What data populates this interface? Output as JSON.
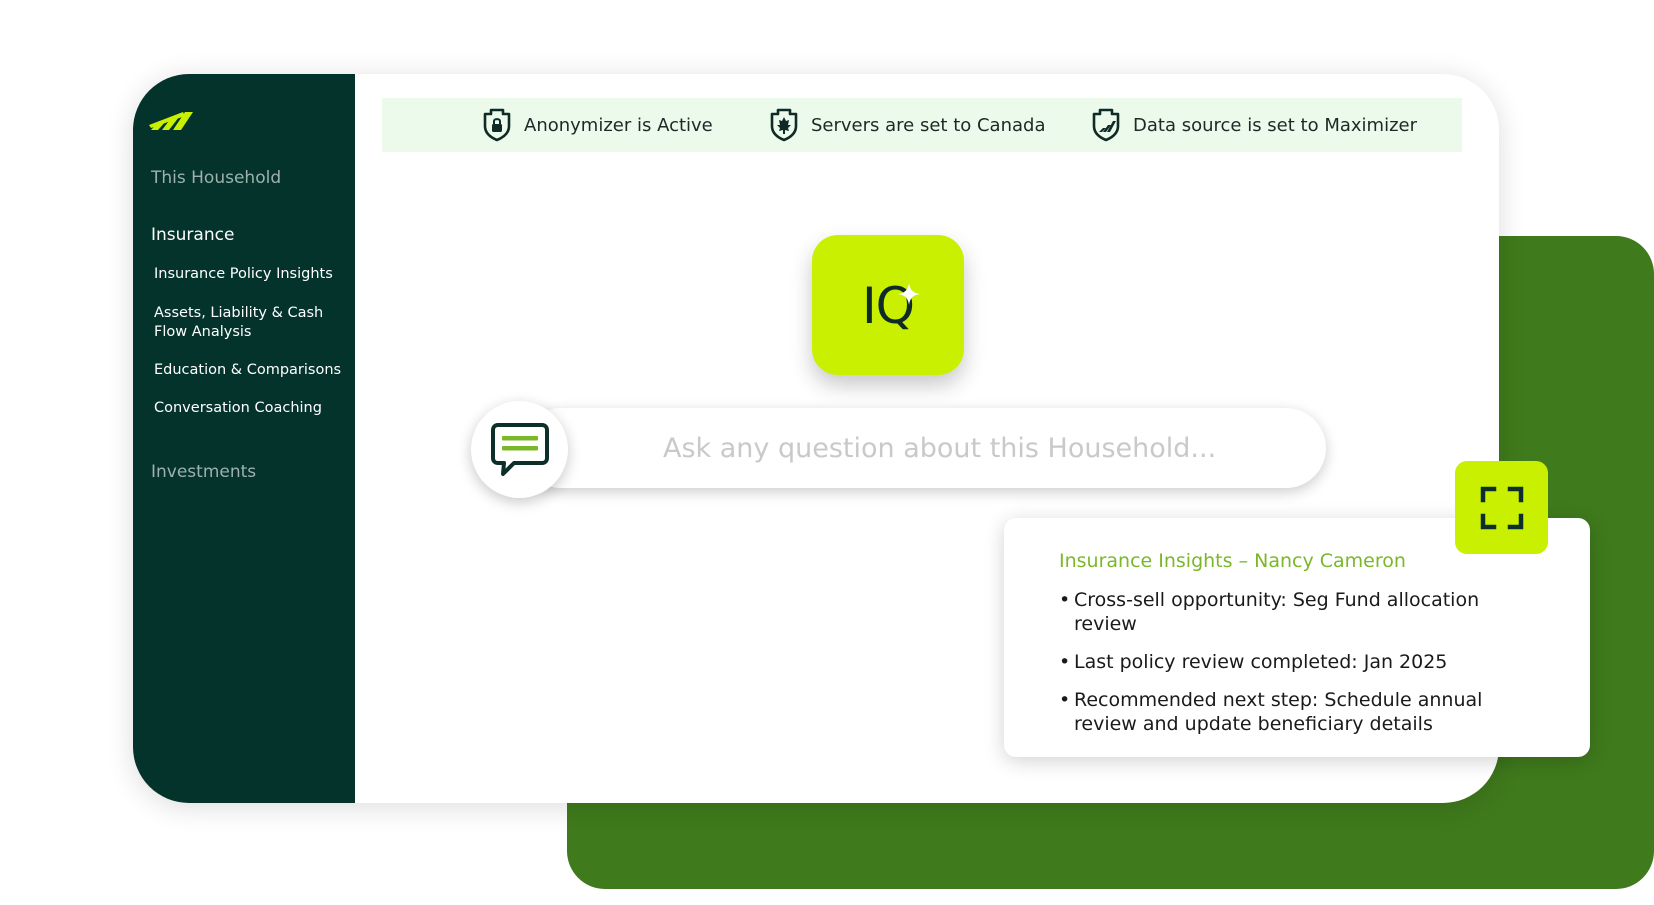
{
  "colors": {
    "sidebar_bg": "#04332c",
    "accent_lime": "#c8f000",
    "brand_green": "#3f7a1c",
    "status_bar_bg": "#ebfaea",
    "insights_title": "#7ab82a"
  },
  "sidebar": {
    "logo_icon": "brand-logo-icon",
    "sections": [
      {
        "label": "This Household",
        "active": false
      },
      {
        "label": "Insurance",
        "active": true
      },
      {
        "label": "Investments",
        "active": false
      }
    ],
    "insurance_items": [
      {
        "label": "Insurance Policy Insights"
      },
      {
        "label": "Assets, Liability & Cash Flow Analysis"
      },
      {
        "label": "Education & Comparisons"
      },
      {
        "label": "Conversation Coaching"
      }
    ]
  },
  "status_bar": {
    "items": [
      {
        "label": "Anonymizer is Active",
        "icon": "shield-lock-icon"
      },
      {
        "label": "Servers are set to Canada",
        "icon": "shield-maple-leaf-icon"
      },
      {
        "label": "Data source is set to Maximizer",
        "icon": "shield-logo-icon"
      }
    ]
  },
  "iq_tile": {
    "label": "IQ",
    "icon": "sparkle-icon"
  },
  "search": {
    "placeholder": "Ask any question about this Household...",
    "value": "",
    "icon": "chat-bubble-icon"
  },
  "insights": {
    "title": "Insurance Insights – Nancy Cameron",
    "items": [
      "Cross-sell opportunity: Seg Fund allocation review",
      "Last policy review completed: Jan 2025",
      "Recommended next step: Schedule annual review and update beneficiary details"
    ],
    "expand_icon": "expand-icon"
  }
}
